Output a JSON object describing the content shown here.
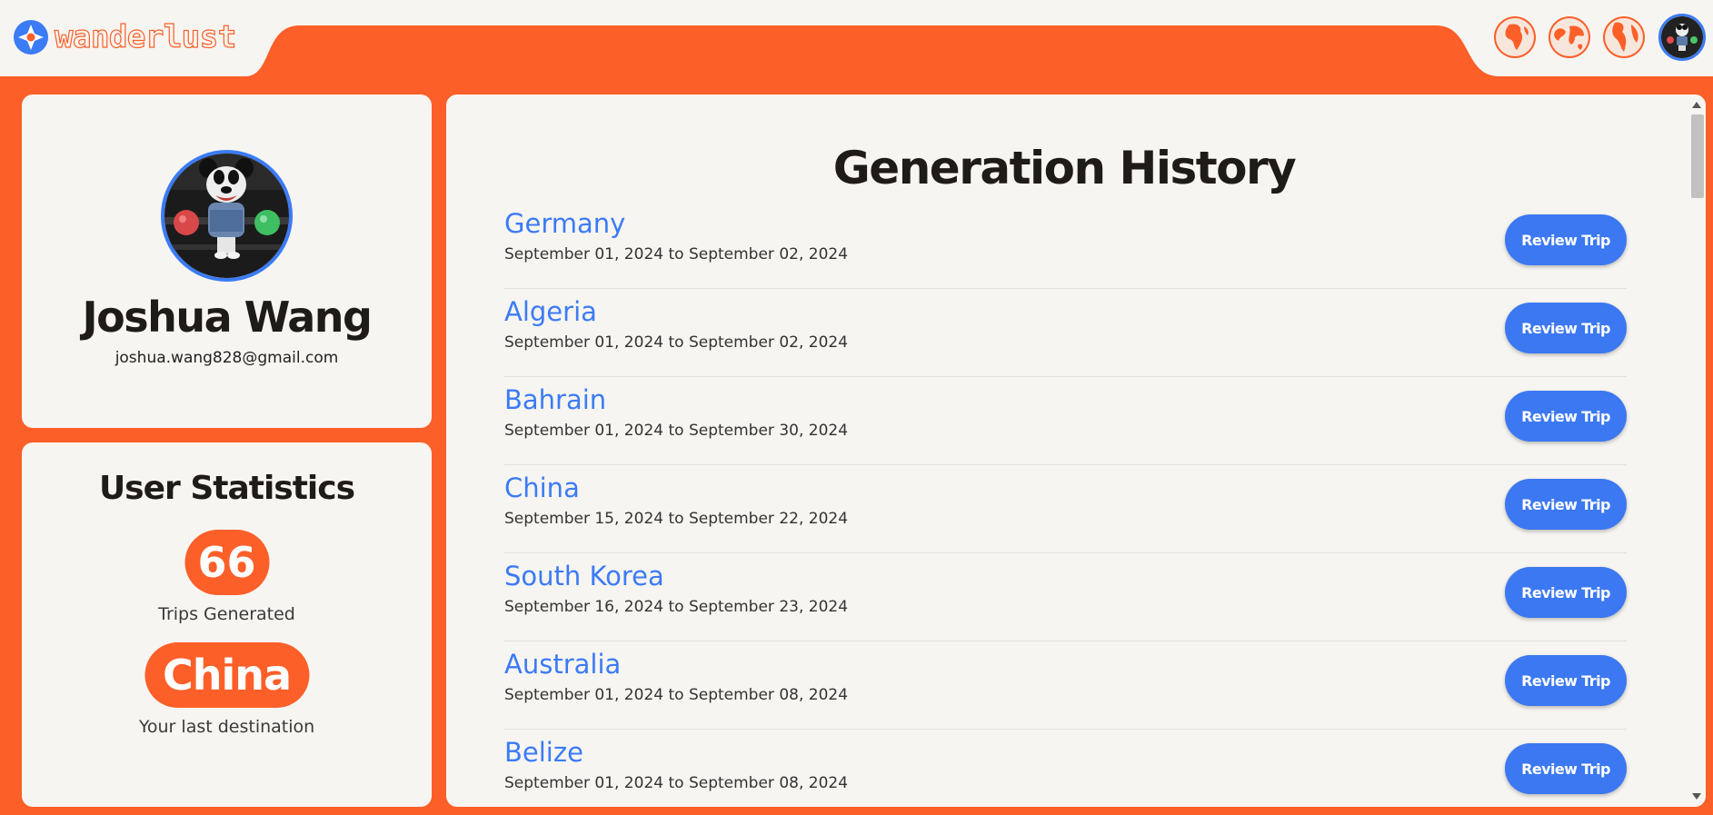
{
  "brand": {
    "name": "wanderlust"
  },
  "colors": {
    "accent": "#fd5f29",
    "blue": "#3b7bf6",
    "card": "#f7f5f1"
  },
  "nav": {
    "icons": [
      "globe-africa-icon",
      "globe-world-icon",
      "globe-americas-icon"
    ]
  },
  "profile": {
    "name": "Joshua Wang",
    "email": "joshua.wang828@gmail.com"
  },
  "stats": {
    "title": "User Statistics",
    "trips_count": "66",
    "trips_label": "Trips Generated",
    "last_destination": "China",
    "last_destination_label": "Your last destination"
  },
  "history": {
    "title": "Generation History",
    "button_label": "Review Trip",
    "trips": [
      {
        "country": "Germany",
        "dates": "September 01, 2024 to September 02, 2024"
      },
      {
        "country": "Algeria",
        "dates": "September 01, 2024 to September 02, 2024"
      },
      {
        "country": "Bahrain",
        "dates": "September 01, 2024 to September 30, 2024"
      },
      {
        "country": "China",
        "dates": "September 15, 2024 to September 22, 2024"
      },
      {
        "country": "South Korea",
        "dates": "September 16, 2024 to September 23, 2024"
      },
      {
        "country": "Australia",
        "dates": "September 01, 2024 to September 08, 2024"
      },
      {
        "country": "Belize",
        "dates": "September 01, 2024 to September 08, 2024"
      }
    ]
  }
}
